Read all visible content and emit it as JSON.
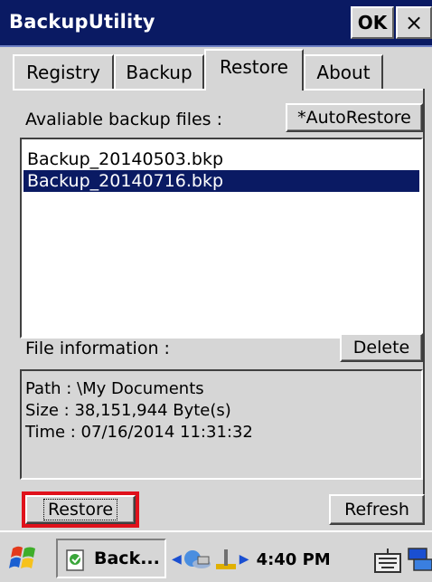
{
  "window": {
    "title": "BackupUtility",
    "ok_label": "OK",
    "close_label": "×"
  },
  "tabs": [
    {
      "label": "Registry",
      "active": false
    },
    {
      "label": "Backup",
      "active": false
    },
    {
      "label": "Restore",
      "active": true
    },
    {
      "label": "About",
      "active": false
    }
  ],
  "restore_tab": {
    "available_label": "Avaliable backup files :",
    "autorestore_label": "*AutoRestore",
    "files": [
      {
        "name": "Backup_20140503.bkp",
        "selected": false
      },
      {
        "name": "Backup_20140716.bkp",
        "selected": true
      }
    ],
    "file_info_label": "File information :",
    "delete_label": "Delete",
    "info_lines": [
      "Path : \\My Documents",
      "Size : 38,151,944 Byte(s)",
      "Time : 07/16/2014 11:31:32"
    ],
    "restore_label": "Restore",
    "refresh_label": "Refresh"
  },
  "taskbar": {
    "app_label": "Back...",
    "time": "4:40 PM",
    "icons": [
      "start-flag-icon",
      "app-backup-icon",
      "network-icon",
      "connection-icon",
      "keyboard-icon",
      "desktop-icon"
    ]
  },
  "colors": {
    "titlebar": "#0a1a63",
    "selection": "#0a1a63",
    "face": "#d6d6d6",
    "highlight_outline": "#e0111b"
  }
}
